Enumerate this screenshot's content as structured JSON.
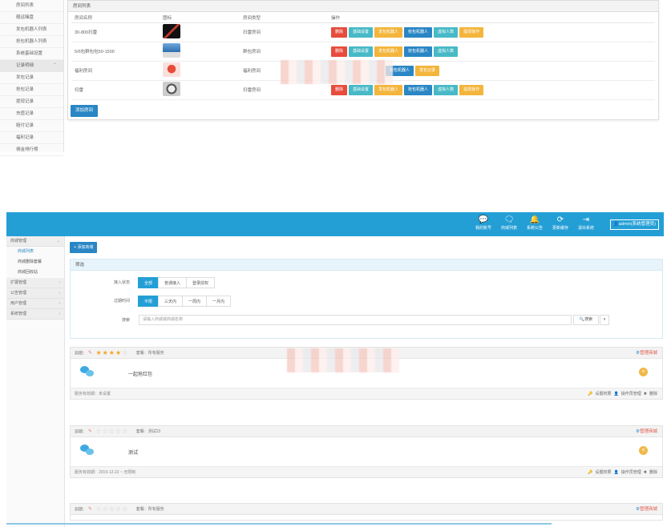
{
  "top": {
    "sidebar": {
      "items": [
        "房间列表",
        "靓运赌盘",
        "发包机器人列表",
        "抢包机器人列表",
        "系统基础设置"
      ],
      "section": "记录明细",
      "sub_items": [
        "发包记录",
        "抢包记录",
        "提现记录",
        "充值记录",
        "赔付记录",
        "福利记录",
        "佣金排行榜"
      ]
    },
    "panel_title": "房间列表",
    "table": {
      "headers": [
        "房间名称",
        "图标",
        "房间类型",
        "操作"
      ],
      "rows": [
        {
          "name": "30-800扫雷",
          "type": "扫雷房间",
          "actions": [
            "删除",
            "基础设置",
            "发包机器人",
            "抢包机器人",
            "虚拟人数",
            "提现操作"
          ]
        },
        {
          "name": "5/6包群包包50-1500",
          "type": "群包房间",
          "actions": [
            "删除",
            "基础设置",
            "发包机器人",
            "抢包机器人",
            "虚拟人数"
          ]
        },
        {
          "name": "福利房间",
          "type": "福利房间",
          "actions": [
            "抢包机器人",
            "发包记录"
          ]
        },
        {
          "name": "扫雷",
          "type": "扫雷房间",
          "actions": [
            "删除",
            "基础设置",
            "发包机器人",
            "抢包机器人",
            "虚拟人数",
            "提现操作"
          ]
        }
      ]
    },
    "add_room": "添加房间"
  },
  "bottom": {
    "topbar": {
      "items": [
        {
          "icon": "wechat-icon",
          "label": "我的账号"
        },
        {
          "icon": "chat-icon",
          "label": "商城列表"
        },
        {
          "icon": "bell-icon",
          "label": "系统公告"
        },
        {
          "icon": "refresh-icon",
          "label": "更新缓存"
        },
        {
          "icon": "logout-icon",
          "label": "退出系统"
        }
      ],
      "admin": "admin(系统管理员)"
    },
    "sidebar": {
      "groups": [
        {
          "label": "商城管理",
          "subs": [
            "商城列表",
            "商城删除套餐",
            "商城回收站"
          ]
        },
        {
          "label": "扩展管理",
          "subs": []
        },
        {
          "label": "公告管理",
          "subs": []
        },
        {
          "label": "用户管理",
          "subs": []
        },
        {
          "label": "系统管理",
          "subs": []
        }
      ]
    },
    "add_shop": "添加商城",
    "filter": {
      "title": "筛选",
      "row1": {
        "label": "接入状态",
        "options": [
          "全部",
          "普通接入",
          "登录授权"
        ],
        "active": 0
      },
      "row2": {
        "label": "过期时间",
        "options": [
          "不限",
          "三天内",
          "一周内",
          "一月内"
        ],
        "active": 0
      },
      "search": {
        "label": "搜索",
        "placeholder": "请输入商城或商城名称",
        "button": "搜索",
        "dropdown": "▾"
      }
    },
    "cards": [
      {
        "prefix": "到期：",
        "stars": 4,
        "level": "套餐：所有服务",
        "manage": "管理商城",
        "name": "一起抢红包",
        "footer": "服务有效期：未设置",
        "acts": [
          "设置权限",
          "操作员管理",
          "删除"
        ]
      },
      {
        "prefix": "到期：",
        "stars": 0,
        "level": "套餐：测试23",
        "manage": "管理商城",
        "name": "测试",
        "footer": "服务有效期：2019-12-22 ~ 无限制",
        "acts": [
          "设置权限",
          "操作员管理",
          "删除"
        ]
      },
      {
        "prefix": "到期：",
        "stars": 0,
        "level": "套餐：所有服务",
        "manage": "管理商城"
      }
    ]
  }
}
